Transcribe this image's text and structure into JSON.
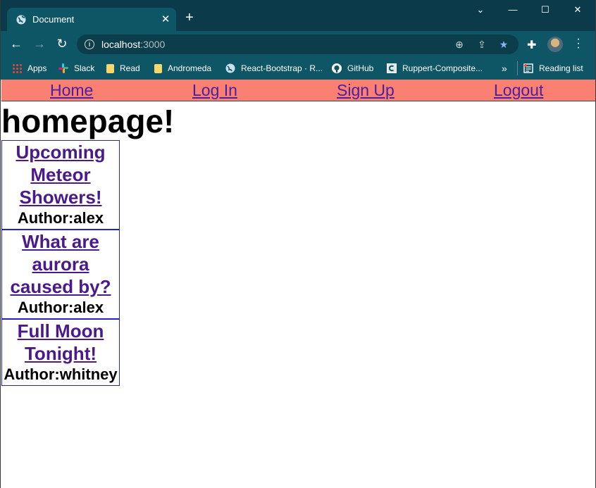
{
  "browser": {
    "tab_title": "Document",
    "tab_close": "✕",
    "new_tab": "+",
    "window_controls": [
      "⌄",
      "—",
      "☐",
      "✕"
    ],
    "url_host": "localhost",
    "url_port": ":3000",
    "bookmarks": [
      {
        "label": "Apps",
        "icon": "apps-grid-icon"
      },
      {
        "label": "Slack",
        "icon": "slack-icon"
      },
      {
        "label": "Read",
        "icon": "folder-icon"
      },
      {
        "label": "Andromeda",
        "icon": "folder-icon"
      },
      {
        "label": "React-Bootstrap · R...",
        "icon": "globe-icon"
      },
      {
        "label": "GitHub",
        "icon": "github-icon"
      },
      {
        "label": "Ruppert-Composite...",
        "icon": "page-icon"
      }
    ],
    "more_bookmarks": "»",
    "reading_list": "Reading list"
  },
  "nav": {
    "home": "Home",
    "login": "Log In",
    "signup": "Sign Up",
    "logout": "Logout"
  },
  "page": {
    "heading": "homepage!"
  },
  "posts": [
    {
      "title": "Upcoming Meteor Showers!",
      "author": "Author:alex"
    },
    {
      "title": "What are aurora caused by?",
      "author": "Author:alex"
    },
    {
      "title": "Full Moon Tonight!",
      "author": "Author:whitney"
    }
  ],
  "colors": {
    "navbar": "#fa8072",
    "link_visited": "#4a1a8a",
    "post_border": "#2222cc",
    "chrome_dark": "#0b3a4a",
    "chrome": "#0e5566"
  }
}
